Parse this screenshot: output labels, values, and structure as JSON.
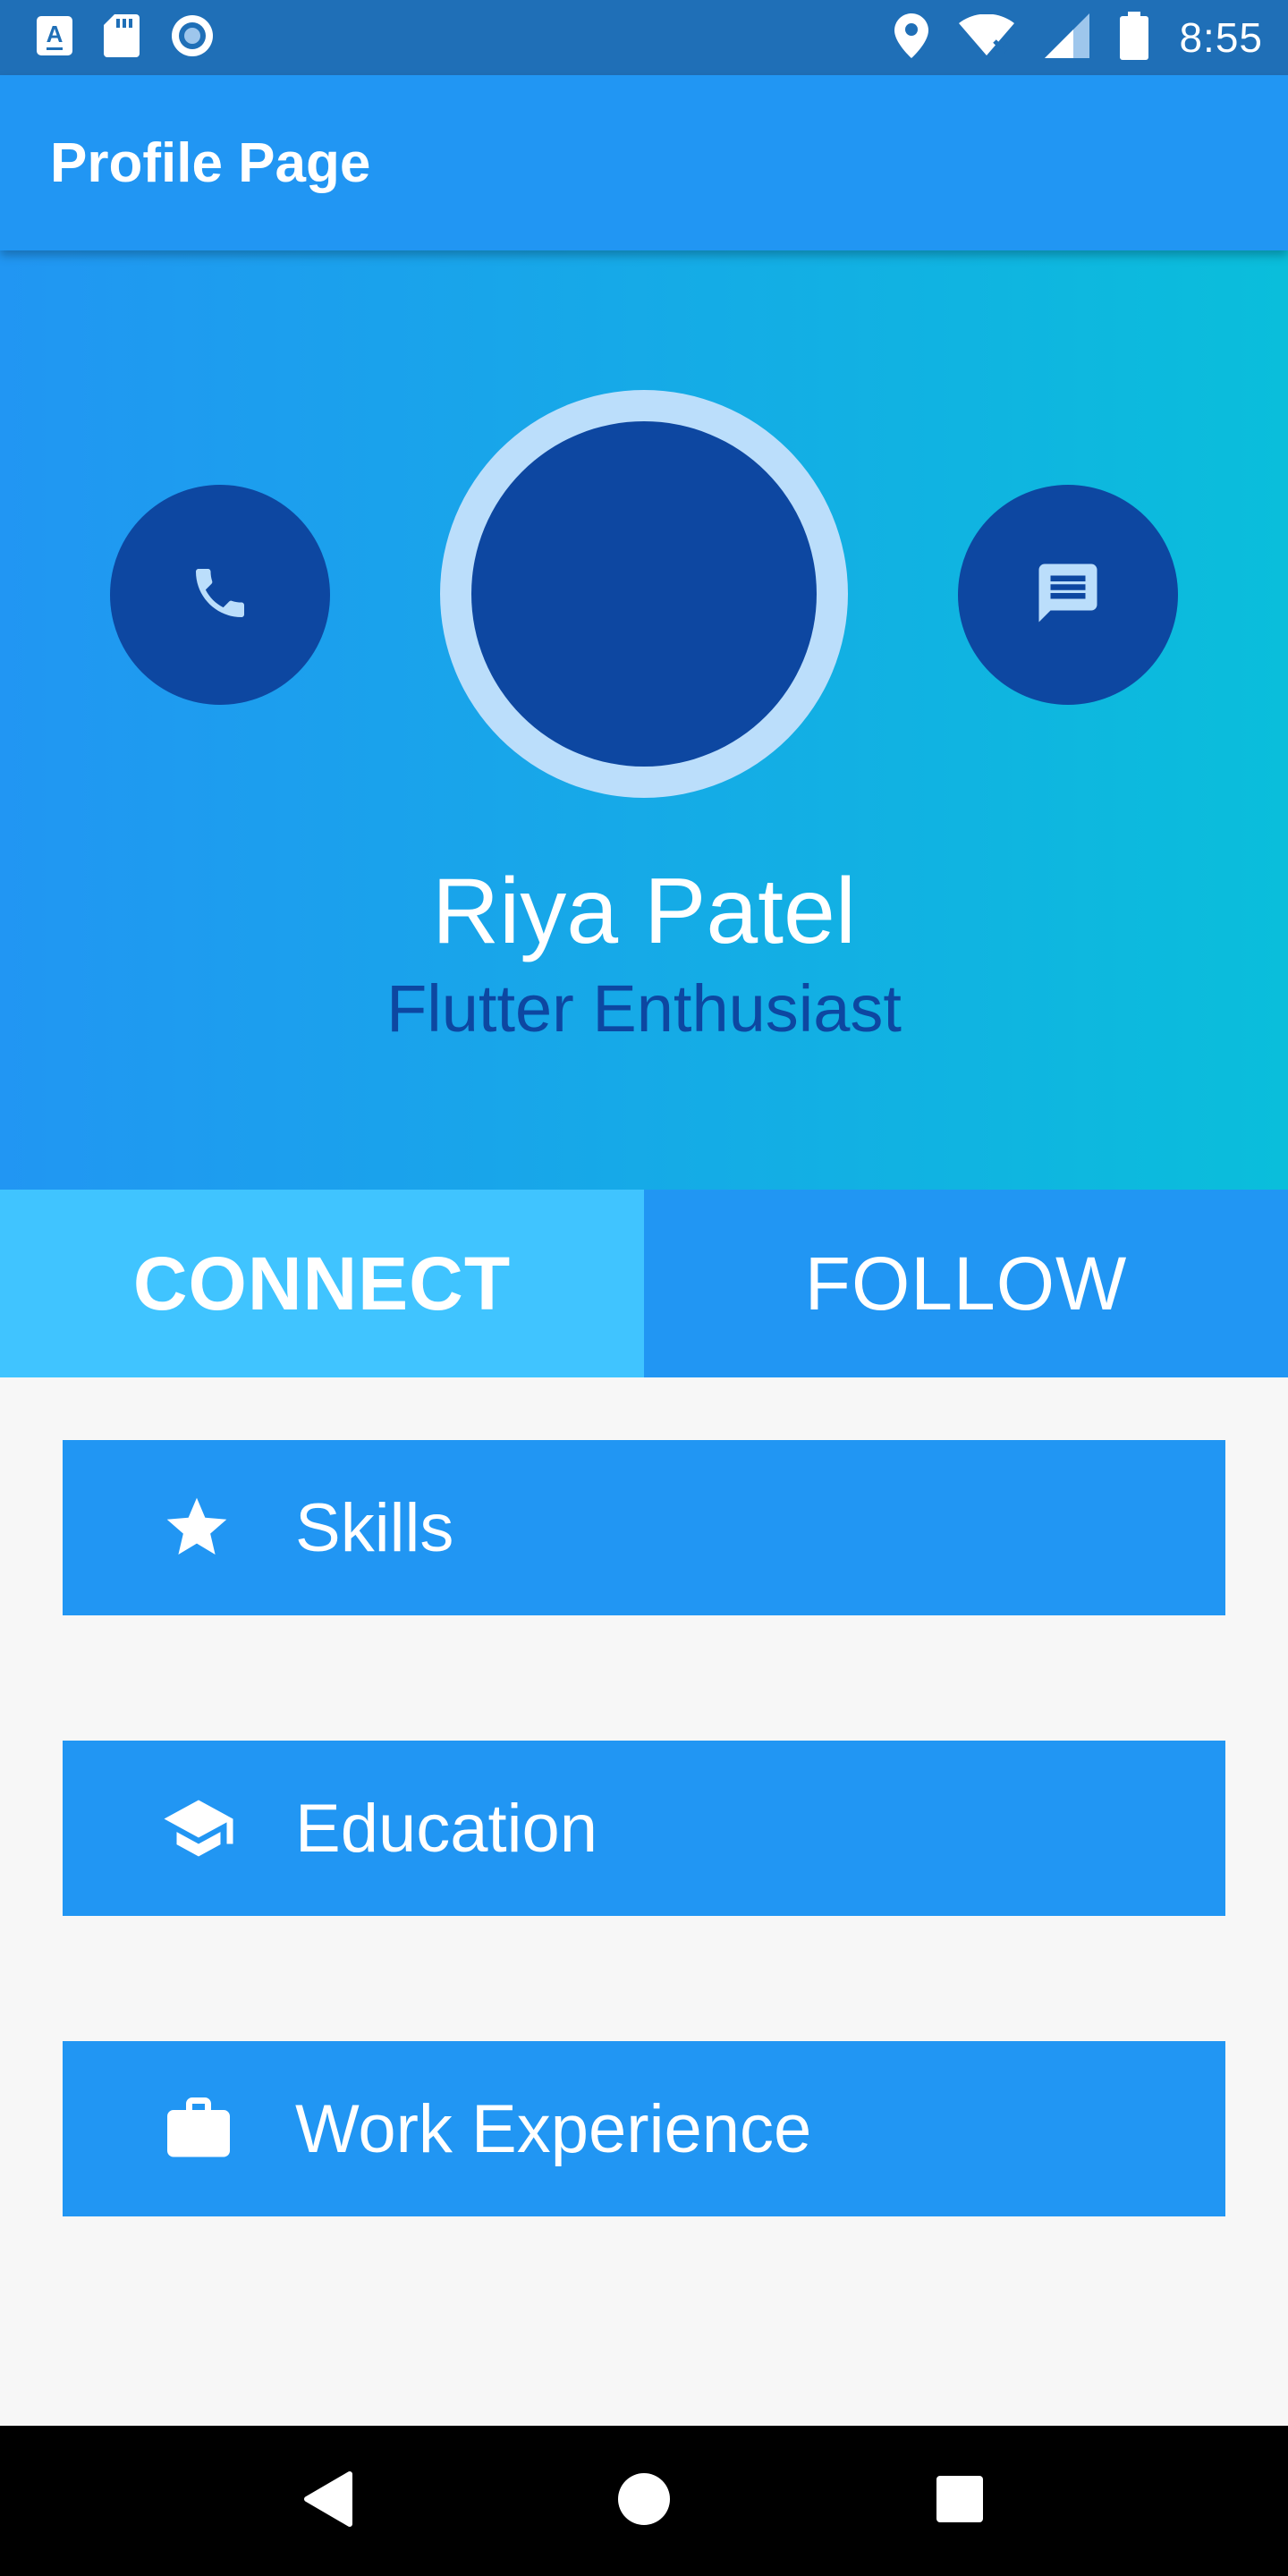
{
  "status_bar": {
    "time": "8:55",
    "left_icons": [
      "keyboard-a-icon",
      "sd-card-icon",
      "record-circle-icon"
    ],
    "right_icons": [
      "location-pin-icon",
      "wifi-icon",
      "cellular-signal-icon",
      "battery-icon"
    ]
  },
  "app_bar": {
    "title": "Profile Page"
  },
  "profile": {
    "name": "Riya Patel",
    "tagline": "Flutter Enthusiast",
    "call_icon": "phone-icon",
    "message_icon": "message-icon"
  },
  "actions": {
    "connect_label": "CONNECT",
    "follow_label": "FOLLOW"
  },
  "sections": [
    {
      "label": "Skills",
      "icon": "star-icon"
    },
    {
      "label": "Education",
      "icon": "graduation-cap-icon"
    },
    {
      "label": "Work Experience",
      "icon": "briefcase-icon"
    }
  ],
  "nav_bar": {
    "back_icon": "back-triangle-icon",
    "home_icon": "home-circle-icon",
    "recents_icon": "recents-square-icon"
  },
  "colors": {
    "status_bar": "#1f6fb7",
    "primary": "#2196f3",
    "gradient_end": "#0abedb",
    "dark_blue": "#0d47a1",
    "avatar_ring": "#bbdefb",
    "connect_accent": "#40c4ff"
  }
}
